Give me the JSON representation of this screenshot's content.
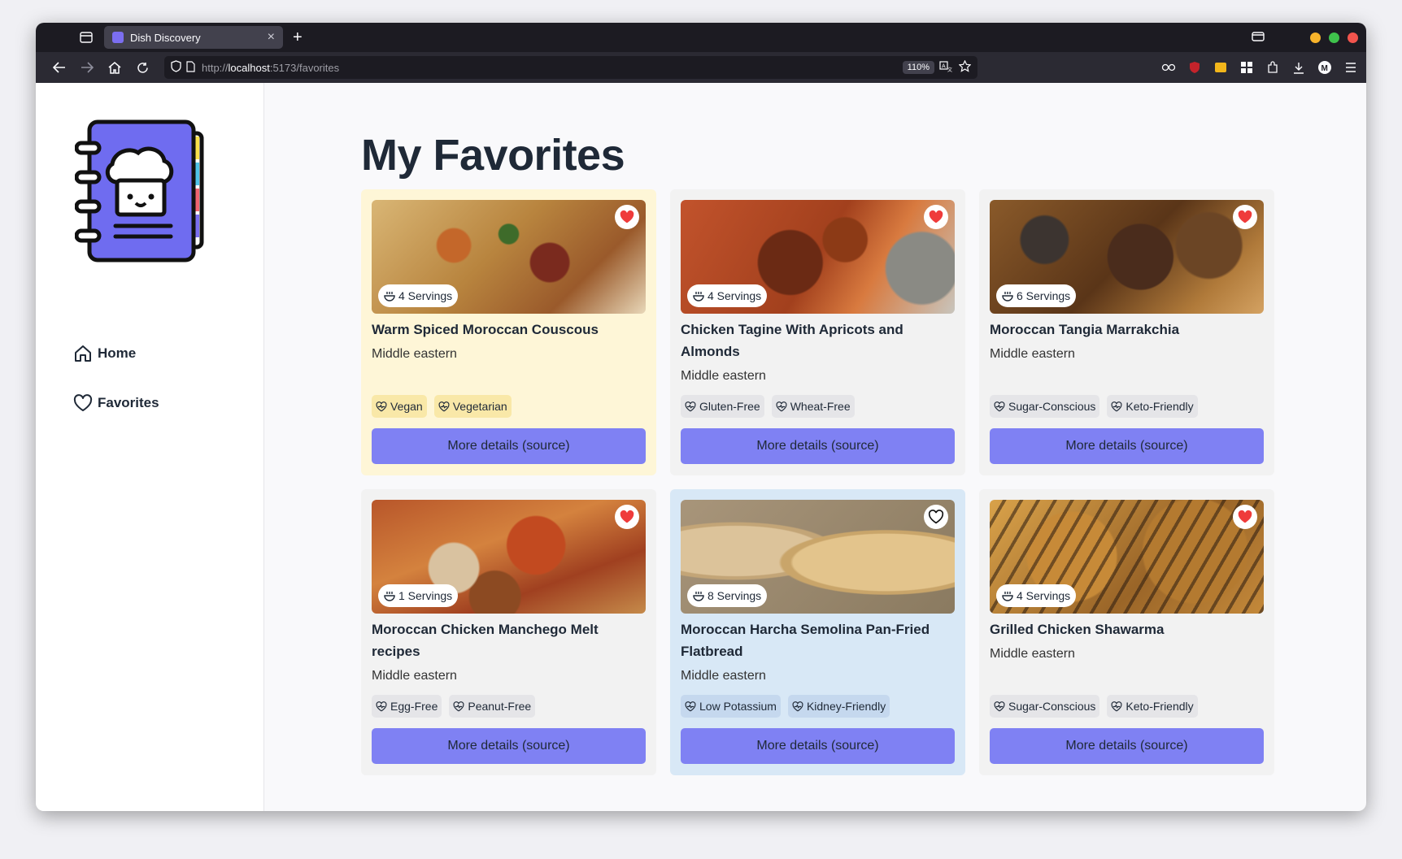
{
  "browser": {
    "tab_title": "Dish Discovery",
    "tab_close": "×",
    "new_tab": "+",
    "url_prefix": "http://",
    "url_host": "localhost",
    "url_rest": ":5173/favorites",
    "zoom": "110%"
  },
  "sidebar": {
    "items": [
      {
        "label": "Home",
        "icon": "home-icon"
      },
      {
        "label": "Favorites",
        "icon": "heart-outline-icon"
      }
    ]
  },
  "page": {
    "title": "My Favorites"
  },
  "button_label": "More details (source)",
  "cards": [
    {
      "title": "Warm Spiced Moroccan Couscous",
      "cuisine": "Middle eastern",
      "servings": "4 Servings",
      "favorited": true,
      "tags": [
        "Vegan",
        "Vegetarian"
      ]
    },
    {
      "title": "Chicken Tagine With Apricots and Almonds",
      "cuisine": "Middle eastern",
      "servings": "4 Servings",
      "favorited": true,
      "tags": [
        "Gluten-Free",
        "Wheat-Free"
      ]
    },
    {
      "title": "Moroccan Tangia Marrakchia",
      "cuisine": "Middle eastern",
      "servings": "6 Servings",
      "favorited": true,
      "tags": [
        "Sugar-Conscious",
        "Keto-Friendly"
      ]
    },
    {
      "title": "Moroccan Chicken Manchego Melt recipes",
      "cuisine": "Middle eastern",
      "servings": "1 Servings",
      "favorited": true,
      "tags": [
        "Egg-Free",
        "Peanut-Free"
      ]
    },
    {
      "title": "Moroccan Harcha Semolina Pan-Fried Flatbread",
      "cuisine": "Middle eastern",
      "servings": "8 Servings",
      "favorited": false,
      "tags": [
        "Low Potassium",
        "Kidney-Friendly"
      ]
    },
    {
      "title": "Grilled Chicken Shawarma",
      "cuisine": "Middle eastern",
      "servings": "4 Servings",
      "favorited": true,
      "tags": [
        "Sugar-Conscious",
        "Keto-Friendly"
      ]
    }
  ],
  "colors": {
    "accent": "#7f81f3",
    "heart": "#ef3b3b",
    "card_yellow": "#fef6d7",
    "card_blue": "#d8e8f6",
    "card_default": "#f2f2f2"
  }
}
